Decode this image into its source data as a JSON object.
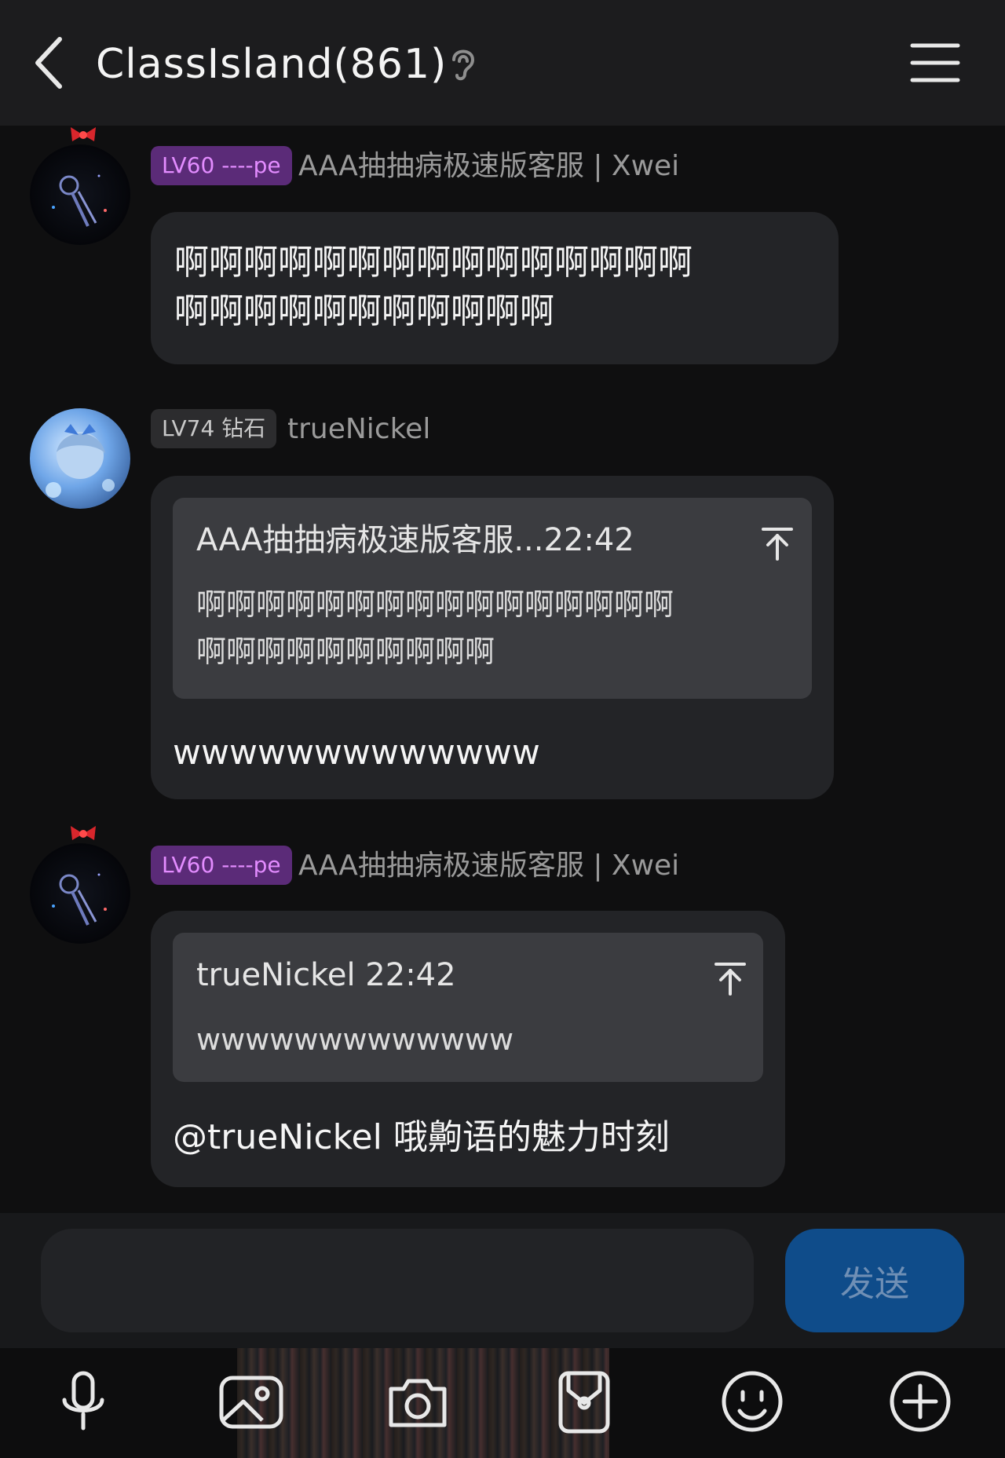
{
  "header": {
    "title": "ClassIsland(861)",
    "back_icon": "chevron-left-icon",
    "ear_icon": "ear-icon",
    "menu_icon": "hamburger-menu-icon"
  },
  "messages": [
    {
      "badge": "LV60 ----pe",
      "sender": "AAA抽抽病极速版客服 | Xwei",
      "text_line1": "啊啊啊啊啊啊啊啊啊啊啊啊啊啊啊",
      "text_line2": "啊啊啊啊啊啊啊啊啊啊啊"
    },
    {
      "badge": "LV74 钻石",
      "sender": "trueNickel",
      "quote_head": "AAA抽抽病极速版客服...22:42",
      "quote_line1": "啊啊啊啊啊啊啊啊啊啊啊啊啊啊啊啊",
      "quote_line2": "啊啊啊啊啊啊啊啊啊啊",
      "text": "wwwwwwwwwwwww"
    },
    {
      "badge": "LV60 ----pe",
      "sender": "AAA抽抽病极速版客服 | Xwei",
      "quote_head": "trueNickel 22:42",
      "quote_line1": "wwwwwwwwwwwww",
      "text": "@trueNickel 哦齁语的魅力时刻"
    }
  ],
  "input": {
    "placeholder": "",
    "send_label": "发送"
  },
  "toolbar": [
    "microphone-icon",
    "image-icon",
    "camera-icon",
    "sticker-icon",
    "emoji-icon",
    "plus-circle-icon"
  ],
  "colors": {
    "background": "#0f0f10",
    "bubble": "#232427",
    "quote": "#3b3c40",
    "badge_purple": "#5b2b78",
    "send_button": "#0f4c8a"
  }
}
